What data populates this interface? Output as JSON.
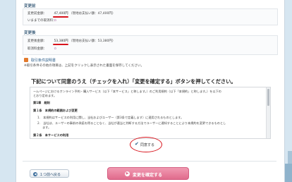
{
  "before": {
    "section_label": "変更前",
    "amount_label": "変更前金額：",
    "amount": "47,400円",
    "amount_note": "（現地お支払い額：47,400円）",
    "cancel_label": "いままでの取消料："
  },
  "after": {
    "section_label": "変更後",
    "amount_label": "変更後金額：",
    "amount": "53,380円",
    "amount_note": "（現地お支払い額：53,380円）",
    "cancel_label": "取消料金額："
  },
  "doc_link": "取引条件説明書",
  "note": "※取引条件その他の項目は、上記をクリックし表示された書面を保存してください。",
  "heading": "下記について同意のうえ（チェックを入れ）「変更を確定する」ボタンを押してください。",
  "terms": {
    "intro1": "ームページにおけるオンライン予約・購入サービス（以下「本サービス」と称します。）のご利用規約（以下「本規約」と称します。）を以下の",
    "intro2": "とおり定めます。",
    "chapter1": "第1章　総則",
    "article1": "第１条　本規約の範囲および変更",
    "item1": "1.　本規約はサービスの利用に関し、当社およびユーザー（第3条で定義します）に適用されるものとします。",
    "item2": "2.　当社は、ユーザーの事前の承諾を得ることなく、当社が適当と判断する方法でユーザーに通知することにより本規約を変更できるものとし",
    "item3": "ます。",
    "article2": "第２条　本サービスの利用"
  },
  "agree_label": "同意する",
  "back_label": "１つ前へ戻る",
  "confirm_label": "変更を確定する",
  "colors": {
    "accent": "#d8141c",
    "confirm": "#e06b8c",
    "link": "#2a5d8a"
  }
}
